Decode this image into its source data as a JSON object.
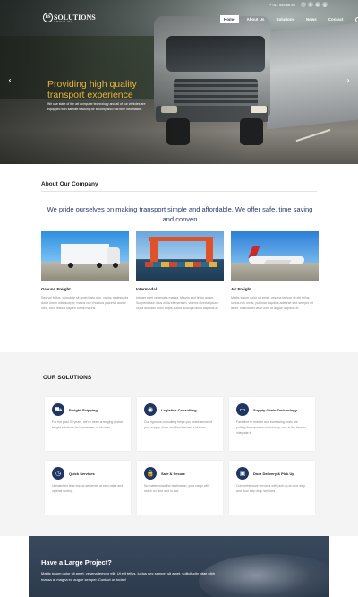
{
  "header": {
    "logo_mark": "BS",
    "logo_name": "SOLUTIONS",
    "logo_sub": "GROUP INC",
    "phone": "+ 011 555 66 56",
    "social": [
      "f",
      "t",
      "in",
      "g"
    ],
    "menu": [
      "Home",
      "About Us",
      "Solutions",
      "News",
      "Contact"
    ],
    "active_menu": "Home"
  },
  "hero": {
    "title_line1": "Providing high quality",
    "title_line2": "transport experience",
    "text": "We use state of the art computer technology and all of our vehicles are equipped with satellite tracking for security and real time information.",
    "prev_arrow": "‹",
    "next_arrow": "›"
  },
  "about": {
    "heading": "About Our Company",
    "lead": "We pride ourselves on making transport simple and affordable. We offer safe, time saving and conven",
    "cards": [
      {
        "title": "Ground Freight",
        "text": "Sed vel tellus, vulputate sit amet justo non, varius malesuada dolor lorem ullamcorper, metus non rhoncus placerat auctor nibh, arcu finibus sapien turpis mauris."
      },
      {
        "title": "Intermodal",
        "text": "Integer eget venenatis massa. Mauris sed tellus quam. Suspendisse risus nulla elementum, viverra viverra ipsum. Nulla aliquam dolor turpis auctor suscipit lacus dapibus at."
      },
      {
        "title": "Air Freight",
        "text": "Mattis ipsum dolor sit amet, vesena tempor ut elit tellus, luctus nec ornar, pulvinar dapibus adeurse sed semper sit amet, sollicitudin vitae nibh ut augue dapibus et."
      }
    ]
  },
  "solutions": {
    "heading": "OUR SOLUTIONS",
    "items": [
      {
        "icon": "truck-icon",
        "glyph": "⛟",
        "title": "Freight Shipping",
        "text": "For the past 35 years, we've been arranging global freight solutions for businesses of all sizes."
      },
      {
        "icon": "compass-icon",
        "glyph": "◉",
        "title": "Logistics Consulting",
        "text": "Our rigorous consulting helps you make sense of your supply chain and find the best solutions."
      },
      {
        "icon": "monitor-icon",
        "glyph": "▭",
        "title": "Supply Chain Technology",
        "text": "Fast time to market and increasing costs are putting the squeeze on industry, now is the time to integrate it."
      },
      {
        "icon": "clock-icon",
        "glyph": "◷",
        "title": "Quick Services",
        "text": "Unmatched time-bound deliveries at best rates and optimal routing."
      },
      {
        "icon": "lock-icon",
        "glyph": "🔒",
        "title": "Safe & Secure",
        "text": "No matter what the destination, your cargo will reach on time and in tact."
      },
      {
        "icon": "box-icon",
        "glyph": "▣",
        "title": "Door Delivery & Pick Up",
        "text": "Comprehensive services with pick up at door step and door step drop services."
      }
    ]
  },
  "cta": {
    "title": "Have a Large Project?",
    "text": "Mattis ipsum dolor sit amet, vesena tempor elit. Ut elit tellus, luctus nec semper sit amet, sollicitudin vitae nibh massa at magna eu augue semper. Contact us today!"
  },
  "colors": {
    "accent": "#e8b635",
    "navy": "#1f3663",
    "lead_blue": "#223a6b"
  }
}
